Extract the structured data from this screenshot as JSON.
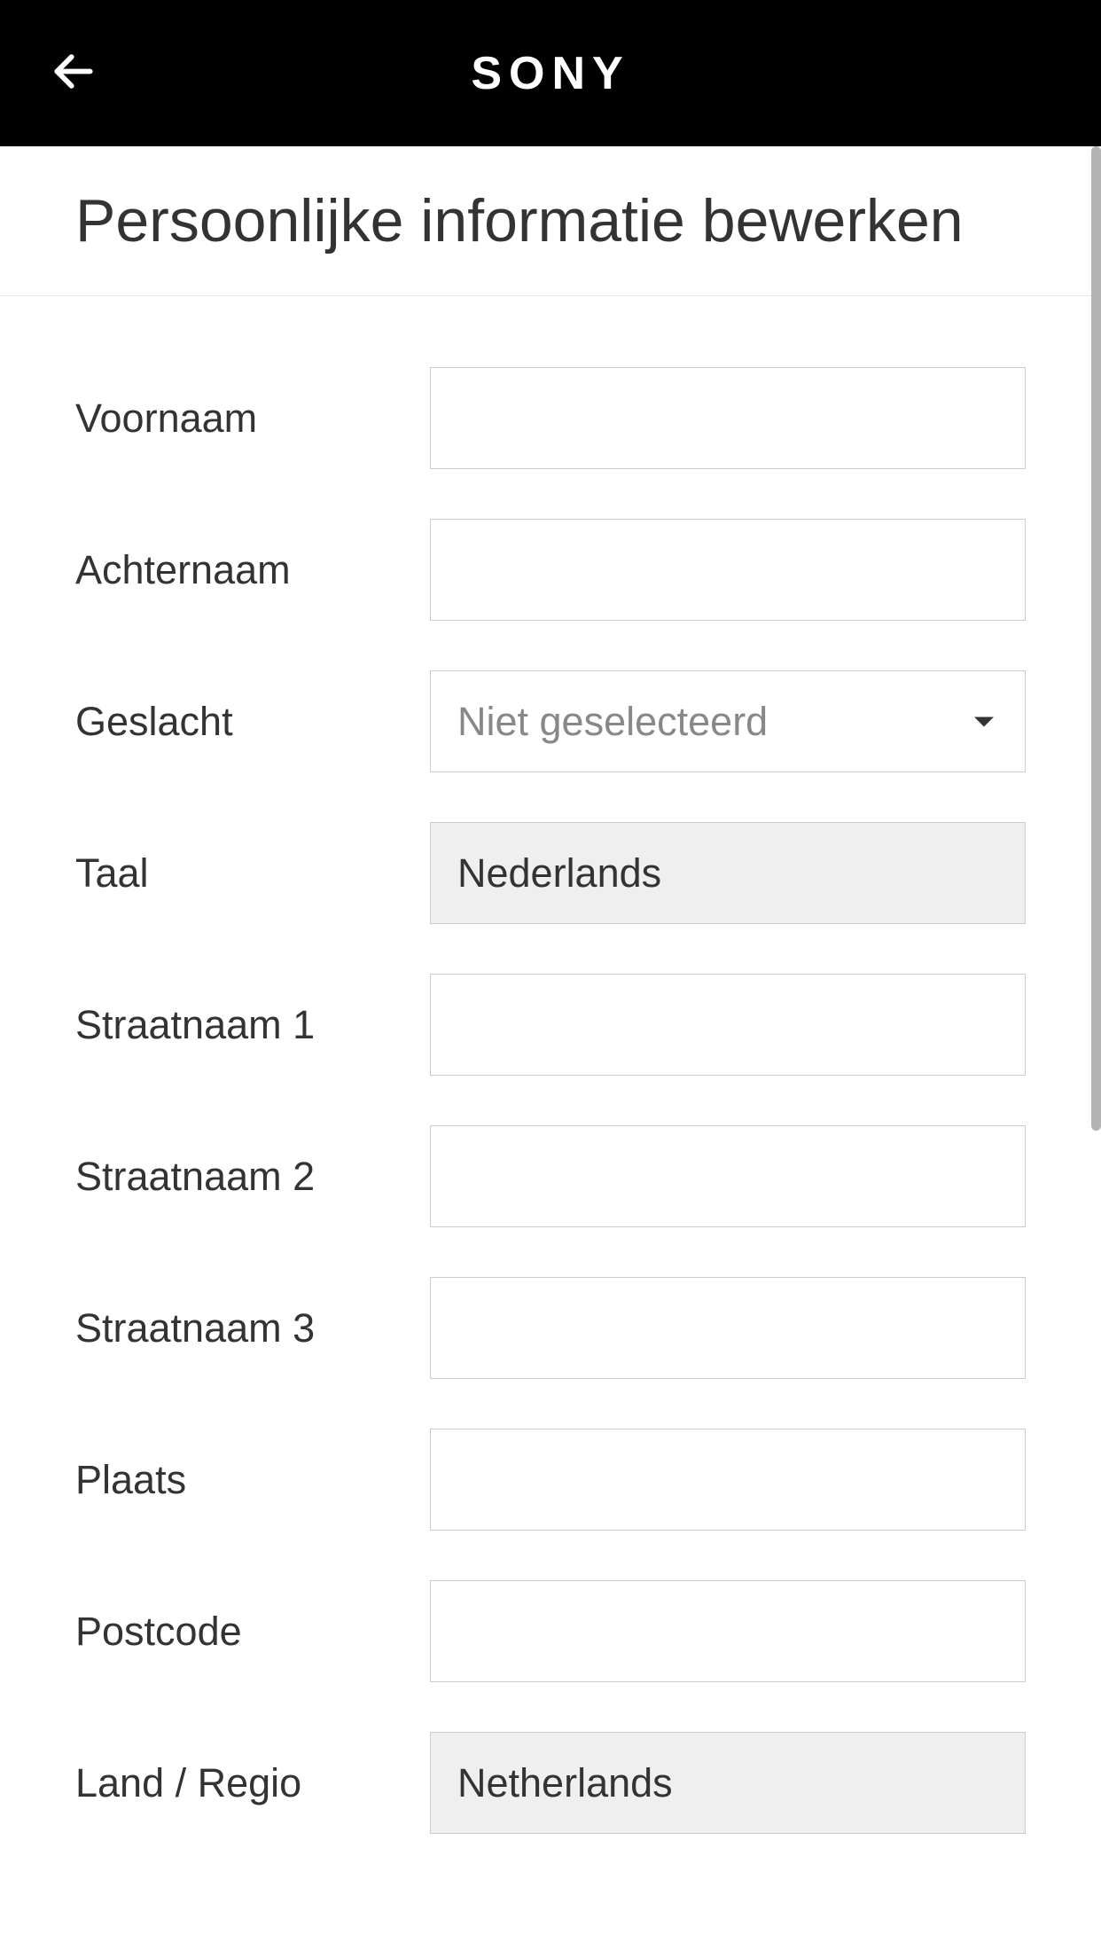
{
  "header": {
    "logo": "SONY"
  },
  "page": {
    "title": "Persoonlijke informatie bewerken"
  },
  "form": {
    "voornaam": {
      "label": "Voornaam",
      "value": ""
    },
    "achternaam": {
      "label": "Achternaam",
      "value": ""
    },
    "geslacht": {
      "label": "Geslacht",
      "placeholder": "Niet geselecteerd"
    },
    "taal": {
      "label": "Taal",
      "value": "Nederlands"
    },
    "straatnaam1": {
      "label": "Straatnaam 1",
      "value": ""
    },
    "straatnaam2": {
      "label": "Straatnaam 2",
      "value": ""
    },
    "straatnaam3": {
      "label": "Straatnaam 3",
      "value": ""
    },
    "plaats": {
      "label": "Plaats",
      "value": ""
    },
    "postcode": {
      "label": "Postcode",
      "value": ""
    },
    "land_regio": {
      "label": "Land / Regio",
      "value": "Netherlands"
    }
  }
}
